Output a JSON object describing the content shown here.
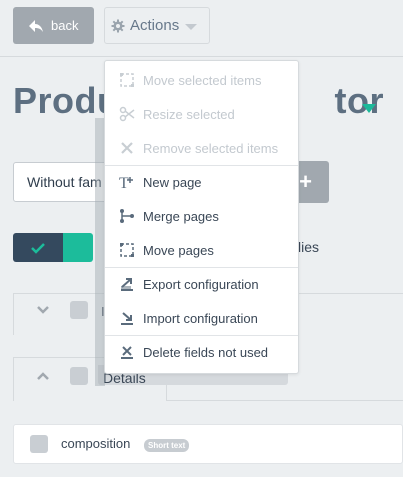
{
  "toolbar": {
    "back_label": "back",
    "actions_label": "Actions"
  },
  "page": {
    "title": "Produ",
    "title_tail": "tor"
  },
  "family_select": {
    "value": "Without fam"
  },
  "add_button": {
    "label": "+"
  },
  "families_label": "lies",
  "panels": {
    "first_letter": "I",
    "details_label": "Details"
  },
  "field": {
    "name": "composition",
    "badge": "Short text"
  },
  "actions_menu": {
    "groups": [
      [
        {
          "label": "Move selected items",
          "icon": "move-icon",
          "disabled": true
        },
        {
          "label": "Resize selected",
          "icon": "scissors-icon",
          "disabled": true
        },
        {
          "label": "Remove selected items",
          "icon": "close-icon",
          "disabled": true
        }
      ],
      [
        {
          "label": "New page",
          "icon": "new-page-icon",
          "disabled": false
        },
        {
          "label": "Merge pages",
          "icon": "merge-icon",
          "disabled": false
        },
        {
          "label": "Move pages",
          "icon": "move-icon",
          "disabled": false
        }
      ],
      [
        {
          "label": "Export configuration",
          "icon": "export-icon",
          "disabled": false
        },
        {
          "label": "Import configuration",
          "icon": "import-icon",
          "disabled": false
        }
      ],
      [
        {
          "label": "Delete fields not used",
          "icon": "delete-icon",
          "disabled": false
        }
      ]
    ]
  },
  "colors": {
    "accent": "#1cbc9b",
    "dark": "#34495e",
    "gray_button": "#a1a8af"
  }
}
